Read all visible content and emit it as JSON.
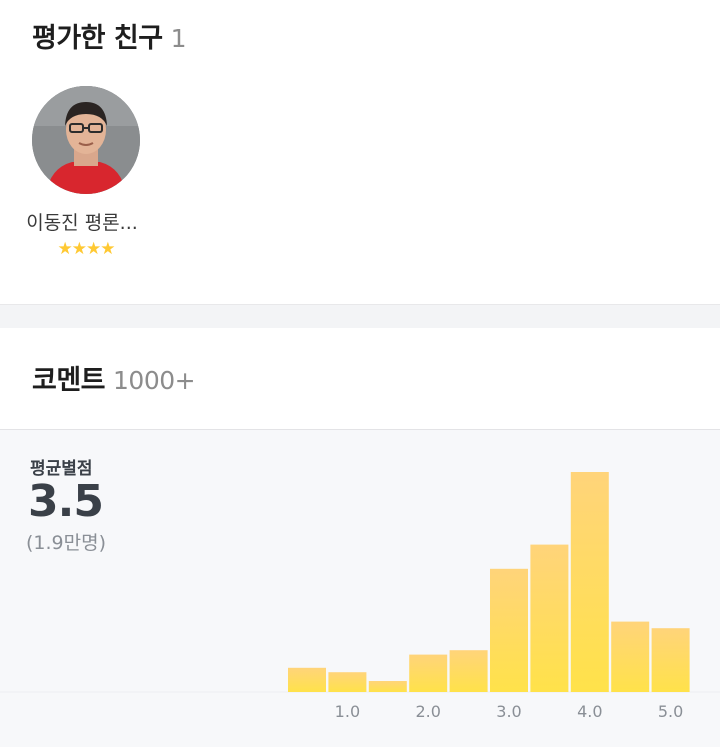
{
  "friends": {
    "title": "평가한 친구",
    "count": "1",
    "items": [
      {
        "name": "이동진 평론...",
        "stars": "★★★★"
      }
    ]
  },
  "comments": {
    "title": "코멘트",
    "count": "1000+"
  },
  "rating": {
    "label": "평균별점",
    "average": "3.5",
    "count_text": "(1.9만명)",
    "colors": {
      "bar_top": "#ffd47a",
      "bar_bottom": "#ffe24a"
    }
  },
  "chart_data": {
    "type": "bar",
    "categories": [
      "0.5",
      "1.0",
      "1.5",
      "2.0",
      "2.5",
      "3.0",
      "3.5",
      "4.0",
      "4.5",
      "5.0"
    ],
    "values": [
      11,
      9,
      5,
      17,
      19,
      56,
      67,
      100,
      32,
      29
    ],
    "tick_labels": [
      "1.0",
      "2.0",
      "3.0",
      "4.0",
      "5.0"
    ],
    "ylim": [
      0,
      100
    ],
    "grid": false
  }
}
